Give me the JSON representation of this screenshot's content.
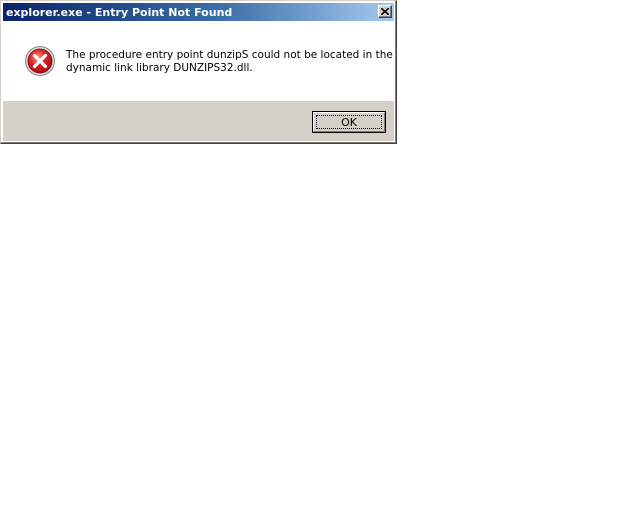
{
  "dialog": {
    "title": "explorer.exe - Entry Point Not Found",
    "message_line1": "The procedure entry point dunzipS could not be located in the",
    "message_line2": "dynamic link library DUNZIPS32.dll.",
    "ok_label": "OK",
    "icon": "error-icon",
    "close_icon": "close-icon"
  }
}
